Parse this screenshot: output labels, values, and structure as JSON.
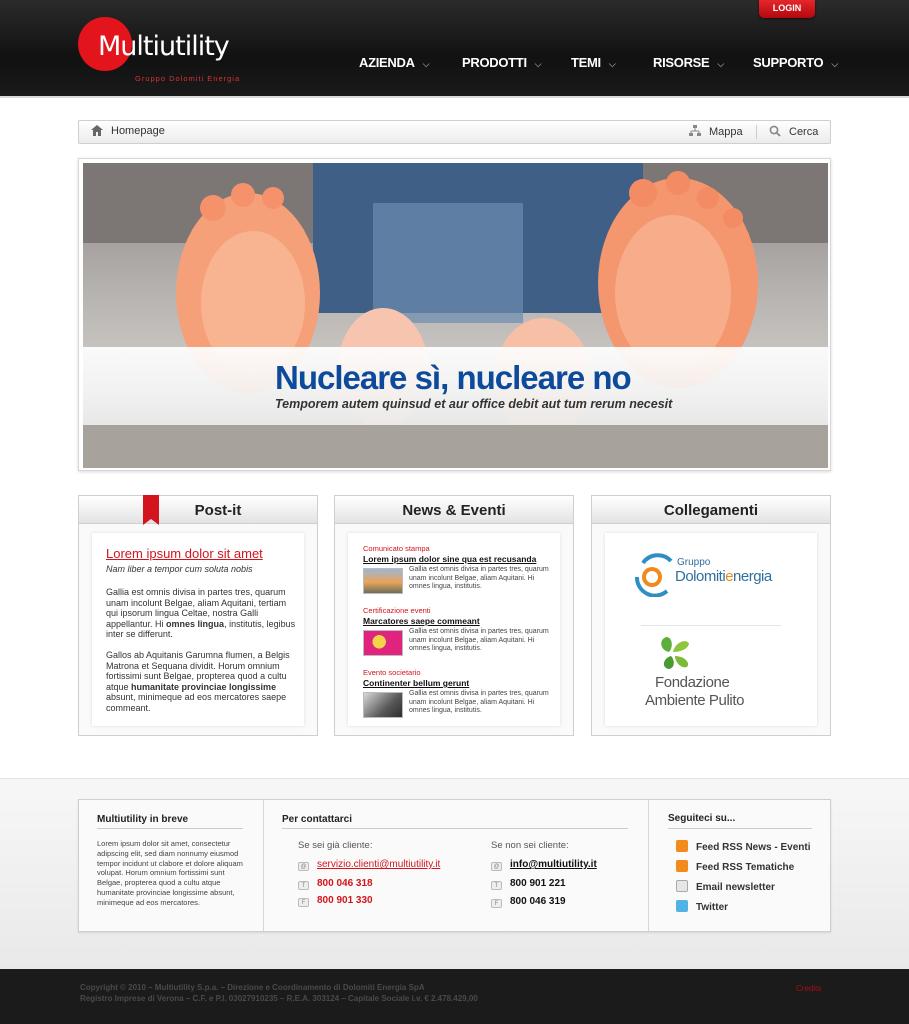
{
  "header": {
    "login_label": "LOGIN",
    "logo_text": "Multiutility",
    "logo_subtitle": "Gruppo Dolomiti Energia",
    "nav": [
      {
        "label": "AZIENDA"
      },
      {
        "label": "PRODOTTI"
      },
      {
        "label": "TEMI"
      },
      {
        "label": "RISORSE"
      },
      {
        "label": "SUPPORTO"
      }
    ]
  },
  "breadcrumb": {
    "home_label": "Homepage",
    "map_label": "Mappa",
    "search_label": "Cerca"
  },
  "hero": {
    "title": "Nucleare sì, nucleare no",
    "subtitle": "Temporem autem quinsud et aur office debit aut tum rerum necesit"
  },
  "postit": {
    "heading": "Post-it",
    "title": "Lorem ipsum dolor sit amet",
    "subtitle": "Nam liber a tempor cum soluta nobis",
    "p1_a": "Gallia est omnis divisa in partes tres, quarum unam incolunt Belgae, aliam Aquitani, tertiam qui ipsorum lingua Celtae, nostra Galli appellantur. Hi ",
    "p1_bold": "omnes lingua",
    "p1_b": ", institutis, legibus inter se differunt.",
    "p2_a": "Gallos ab Aquitanis Garumna flumen, a Belgis Matrona et Sequana dividit. Horum omnium fortissimi sunt Belgae, propterea quod a cultu atque ",
    "p2_bold": "humanitate provinciae longissime",
    "p2_b": " absunt, minimeque ad eos mercatores saepe commeant."
  },
  "news": {
    "heading": "News & Eventi",
    "items": [
      {
        "category": "Comunicato stampa",
        "title": "Lorem ipsum dolor sine qua est recusanda",
        "text": "Gallia est omnis divisa in partes tres, quarum unam incolunt Belgae, aliam Aquitani. Hi omnes lingua, institutis."
      },
      {
        "category": "Certificazione eventi",
        "title": "Marcatores saepe commeant",
        "text": "Gallia est omnis divisa in partes tres, quarum unam incolunt Belgae, aliam Aquitani. Hi omnes lingua, institutis."
      },
      {
        "category": "Evento societario",
        "title": "Continenter bellum gerunt",
        "text": "Gallia est omnis divisa in partes tres, quarum unam incolunt Belgae, aliam Aquitani. Hi omnes lingua, institutis."
      }
    ]
  },
  "links": {
    "heading": "Collegamenti",
    "sponsor1_line1": "Gruppo",
    "sponsor1_line2a": "Dolomiti",
    "sponsor1_line2b": "e",
    "sponsor1_line2c": "nergia",
    "sponsor2_line1": "Fondazione",
    "sponsor2_line2": "Ambiente Pulito"
  },
  "footer": {
    "about_heading": "Multiutility in breve",
    "about_text": "Lorem ipsum dolor sit amet, consectetur adipscing elit, sed diam nonnumy eiusmod tempor incidunt ut clabore et dolore aliquam volupat. Horum omnium fortissimi sunt Belgae, propterea quod a cultu atque humanitate provinciae longissime absunt, minimeque ad eos mercatores.",
    "contact_heading": "Per contattarci",
    "client_label": "Se sei già cliente:",
    "client_email": "servizio.clienti@multiutility.it",
    "client_phone": "800 046 318",
    "client_fax": "800 901 330",
    "nonclient_label": "Se non sei cliente:",
    "nonclient_email": "info@multiutility.it",
    "nonclient_phone": "800 901 221",
    "nonclient_fax": "800 046 319",
    "follow_heading": "Seguiteci su...",
    "social": [
      {
        "label": "Feed RSS News - Eventi",
        "icon": "rss-icon",
        "color": "#f28a1d"
      },
      {
        "label": "Feed RSS Tematiche",
        "icon": "rss-icon",
        "color": "#f28a1d"
      },
      {
        "label": "Email newsletter",
        "icon": "mail-icon",
        "color": "#cfcfcf"
      },
      {
        "label": "Twitter",
        "icon": "twitter-icon",
        "color": "#4fb3e4"
      }
    ]
  },
  "bottom": {
    "copyright_line1": "Copyright © 2010 – Multiutility S.p.a. – Direzione e Coordinamento di Dolomiti Energia SpA",
    "copyright_line2": "Registro Imprese di Verona – C.F. e P.I. 03027910235 – R.E.A. 303124 – Capitale Sociale i.v. € 2.478.429,00",
    "credits_label": "Credits"
  },
  "colors": {
    "brand_red": "#e3141b",
    "hero_blue": "#0d4a9b",
    "dark": "#111111"
  }
}
